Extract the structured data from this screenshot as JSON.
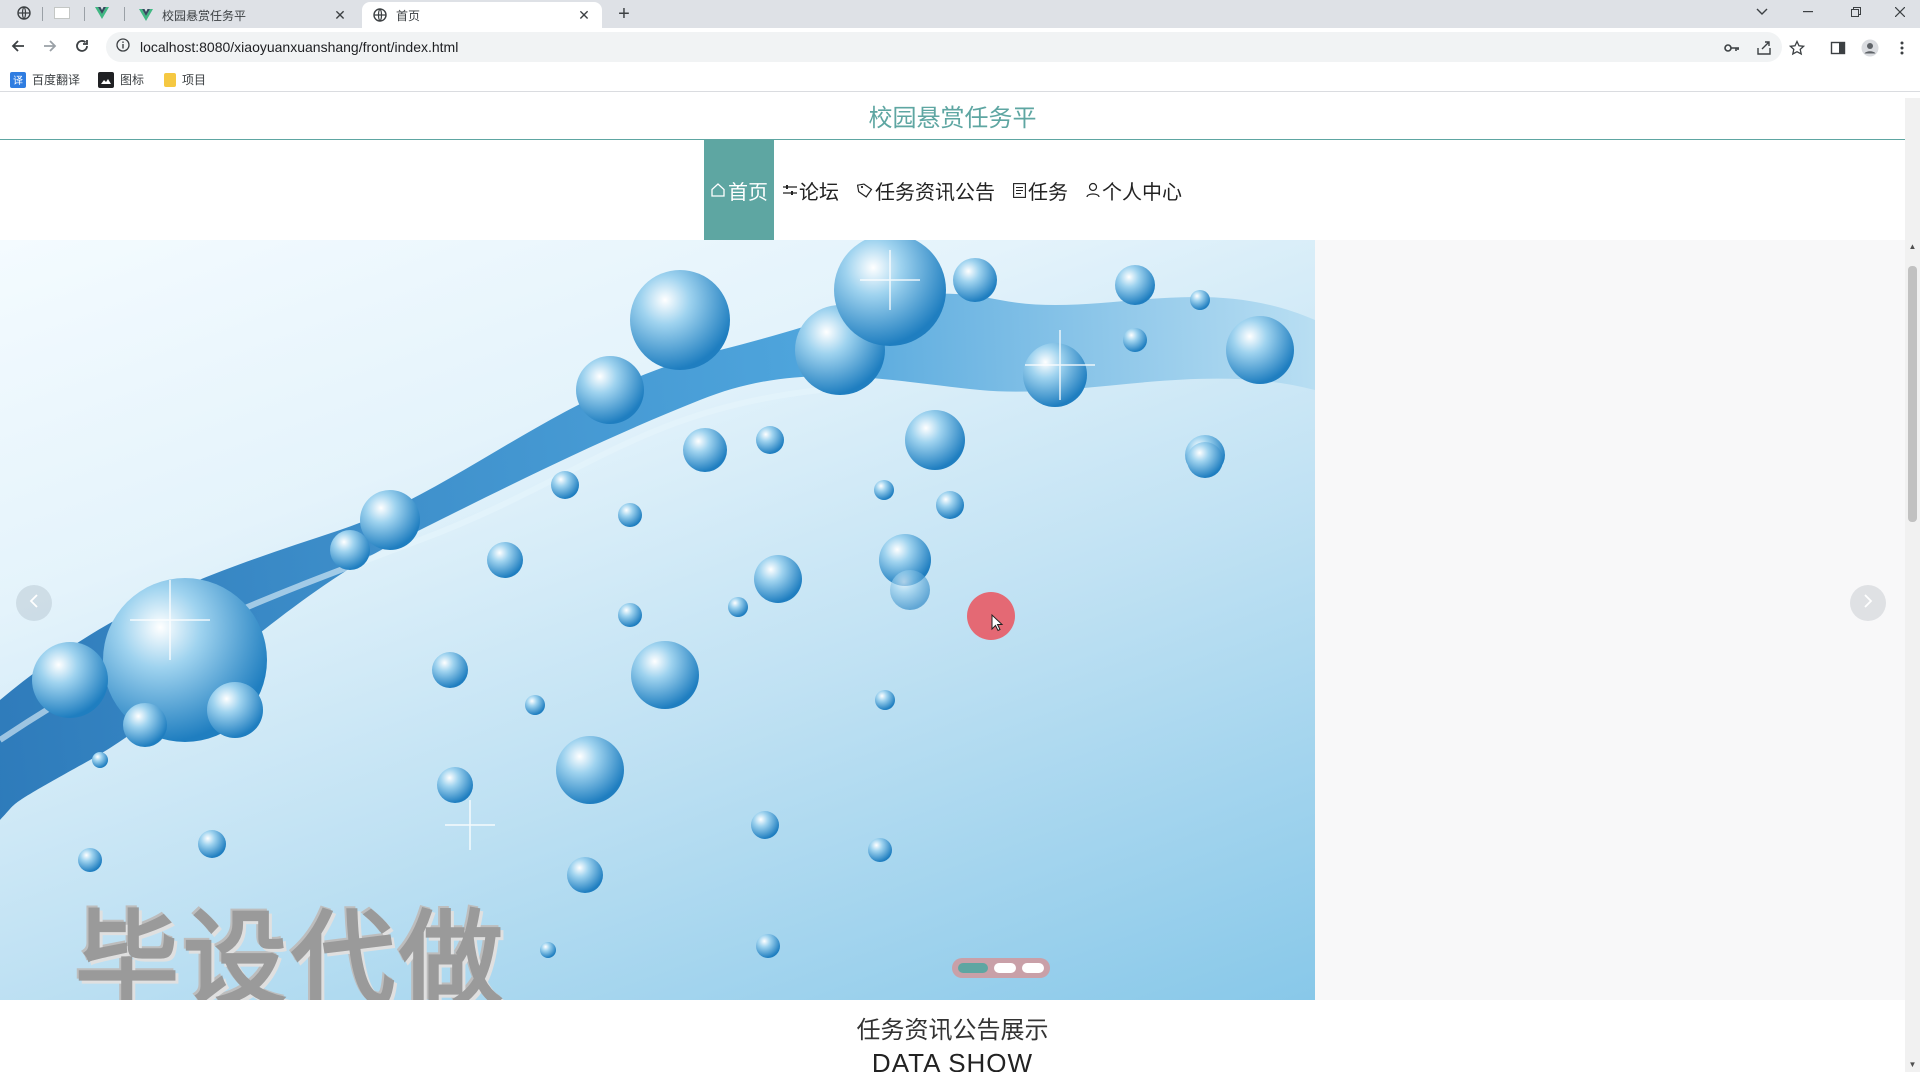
{
  "browser": {
    "tabs": [
      {
        "title": "校园悬赏任务平",
        "active": false
      },
      {
        "title": "首页",
        "active": true
      }
    ],
    "url": "localhost:8080/xiaoyuanxuanshang/front/index.html",
    "bookmarks": [
      {
        "label": "百度翻译",
        "icon": "translate-icon",
        "color": "#2f7de1"
      },
      {
        "label": "图标",
        "icon": "image-icon",
        "color": "#202124"
      },
      {
        "label": "项目",
        "icon": "folder-icon",
        "color": "#f5c842"
      }
    ]
  },
  "site": {
    "title": "校园悬赏任务平",
    "accent": "#5ea6a2"
  },
  "nav": {
    "items": [
      {
        "label": "首页",
        "icon": "home-icon",
        "active": true
      },
      {
        "label": "论坛",
        "icon": "sliders-icon",
        "active": false
      },
      {
        "label": "任务资讯公告",
        "icon": "tag-icon",
        "active": false
      },
      {
        "label": "任务",
        "icon": "document-icon",
        "active": false
      },
      {
        "label": "个人中心",
        "icon": "user-icon",
        "active": false
      }
    ]
  },
  "carousel": {
    "banner_text": "毕设代做",
    "slide_count": 3,
    "active_slide": 1
  },
  "sections": {
    "news_title": "任务资讯公告展示",
    "news_subtitle": "DATA SHOW"
  }
}
